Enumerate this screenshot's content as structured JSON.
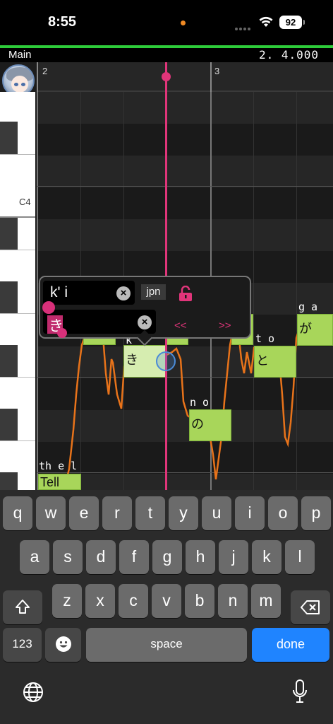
{
  "status_bar": {
    "time": "8:55",
    "battery": "92"
  },
  "header": {
    "track_name": "Main",
    "position": "2. 4.000"
  },
  "ruler": {
    "bars": [
      "2",
      "3"
    ]
  },
  "piano": {
    "c4_label": "C4"
  },
  "notes": [
    {
      "phoneme": "th e l",
      "lyric": "Tell"
    },
    {
      "phoneme": "k",
      "lyric": "き"
    },
    {
      "phoneme": "n o",
      "lyric": "の"
    },
    {
      "phoneme": "t o",
      "lyric": "と"
    },
    {
      "phoneme": "g a",
      "lyric": "が"
    }
  ],
  "popup": {
    "phoneme_value": "k' i",
    "lyric_value": "き",
    "language": "jpn",
    "prev_label": "<<",
    "next_label": ">>"
  },
  "keyboard": {
    "row1": [
      "q",
      "w",
      "e",
      "r",
      "t",
      "y",
      "u",
      "i",
      "o",
      "p"
    ],
    "row2": [
      "a",
      "s",
      "d",
      "f",
      "g",
      "h",
      "j",
      "k",
      "l"
    ],
    "row3": [
      "z",
      "x",
      "c",
      "v",
      "b",
      "n",
      "m"
    ],
    "numbers_label": "123",
    "space_label": "space",
    "done_label": "done"
  },
  "colors": {
    "accent": "#e0357a",
    "note": "#a8d65a",
    "pitch": "#e8731a",
    "done": "#1f84ff"
  }
}
